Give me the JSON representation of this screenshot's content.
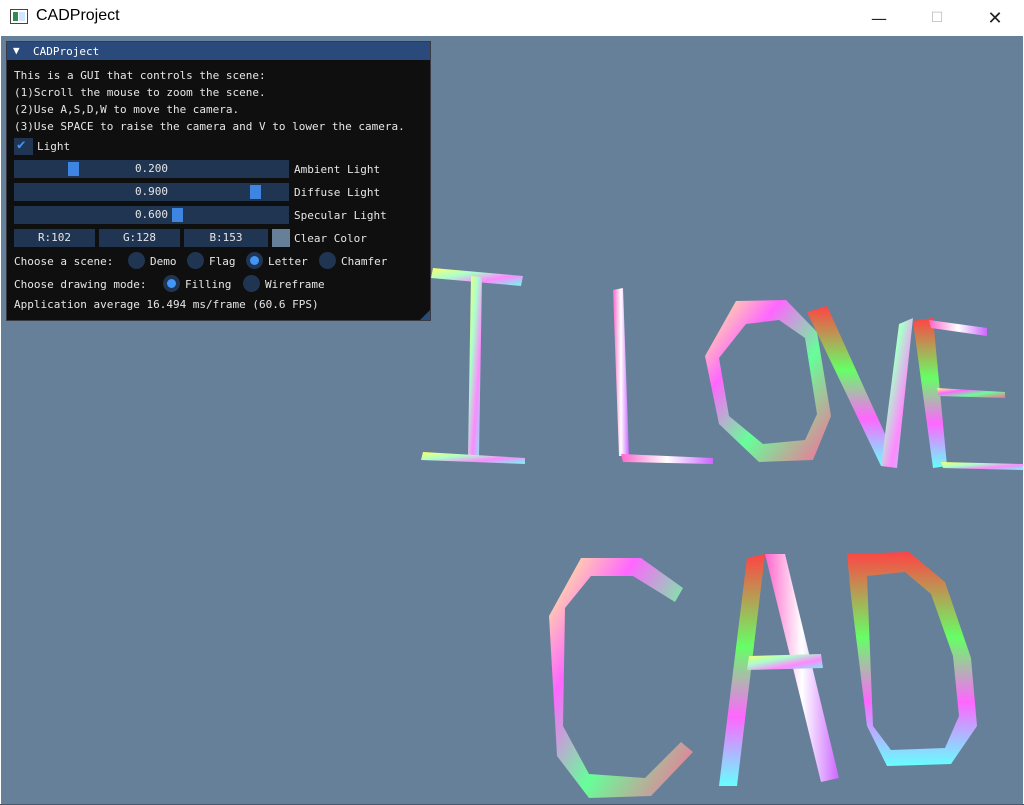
{
  "window": {
    "title": "CADProject",
    "minimize_glyph": "—",
    "maximize_glyph": "☐",
    "close_glyph": "✕"
  },
  "gui": {
    "title": "CADProject",
    "collapse_glyph": "▼",
    "help_lines": [
      "This is a GUI that controls the scene:",
      "(1)Scroll the mouse to zoom the scene.",
      "(2)Use A,S,D,W to move the camera.",
      "(3)Use SPACE to raise the camera and V to lower the camera."
    ],
    "light_checkbox": {
      "label": "Light",
      "checked": true
    },
    "sliders": [
      {
        "label": "Ambient Light",
        "display": "0.200",
        "value": 0.2
      },
      {
        "label": "Diffuse Light",
        "display": "0.900",
        "value": 0.9
      },
      {
        "label": "Specular Light",
        "display": "0.600",
        "value": 0.6
      }
    ],
    "clear_color": {
      "r": "R:102",
      "g": "G:128",
      "b": "B:153",
      "label": "Clear Color",
      "swatch_color": "#668099"
    },
    "scene_choice": {
      "label": "Choose a scene:",
      "options": [
        "Demo",
        "Flag",
        "Letter",
        "Chamfer"
      ],
      "selected": "Letter"
    },
    "drawing_mode": {
      "label": "Choose drawing mode:",
      "options": [
        "Filling",
        "Wireframe"
      ],
      "selected": "Filling"
    },
    "fps_text": "Application average 16.494 ms/frame (60.6 FPS)"
  },
  "viewport": {
    "background": "#668099"
  }
}
